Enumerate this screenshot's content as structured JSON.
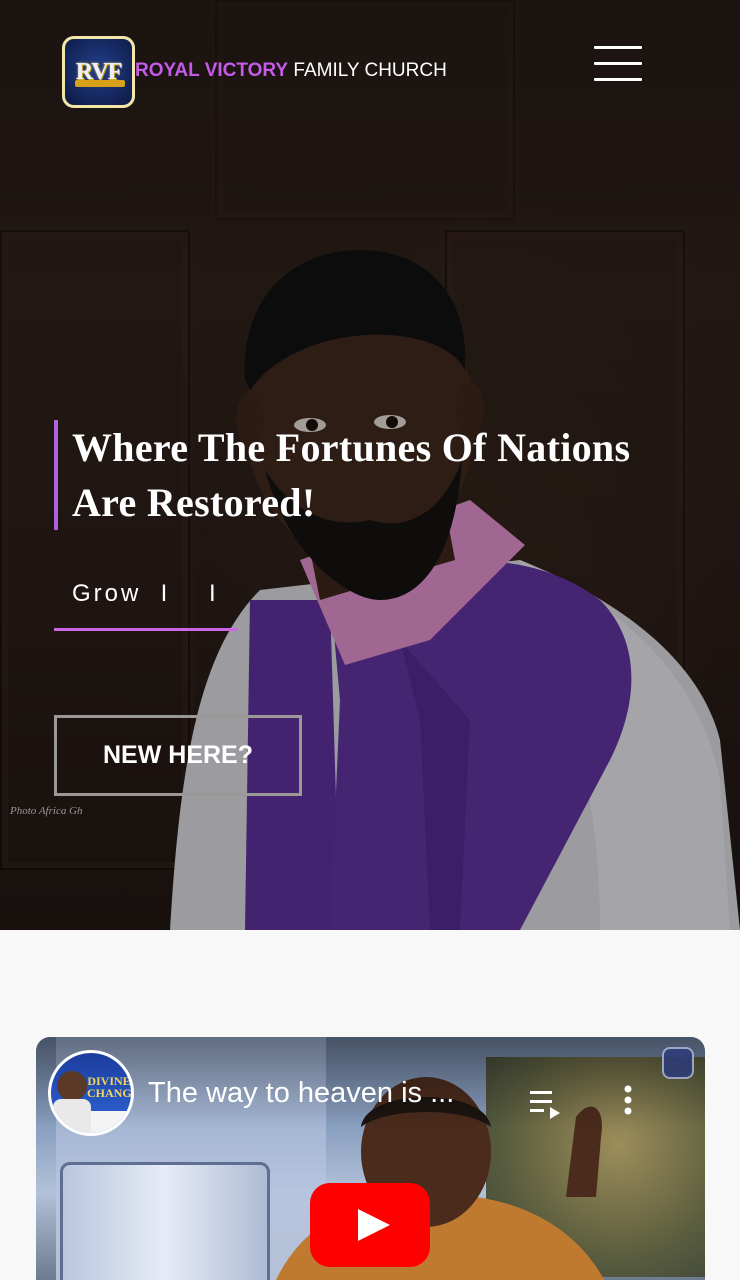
{
  "header": {
    "logo_text": "RVF",
    "brand_accent": "ROYAL VICTORY",
    "brand_rest": " FAMILY CHURCH"
  },
  "hero": {
    "headline_line1": "Where The Fortunes Of Nations",
    "headline_line2": "Are Restored!",
    "typed_text": "Grow  I    I",
    "cta_label": "NEW HERE?",
    "photo_credit": "Photo Africa Gh"
  },
  "video": {
    "title": "The way to heaven is ...",
    "channel_avatar_text": "DIVINE CHANGE"
  },
  "colors": {
    "accent_purple": "#c45ae8",
    "underline_pink": "#cc66e6",
    "youtube_red": "#ff0000"
  }
}
